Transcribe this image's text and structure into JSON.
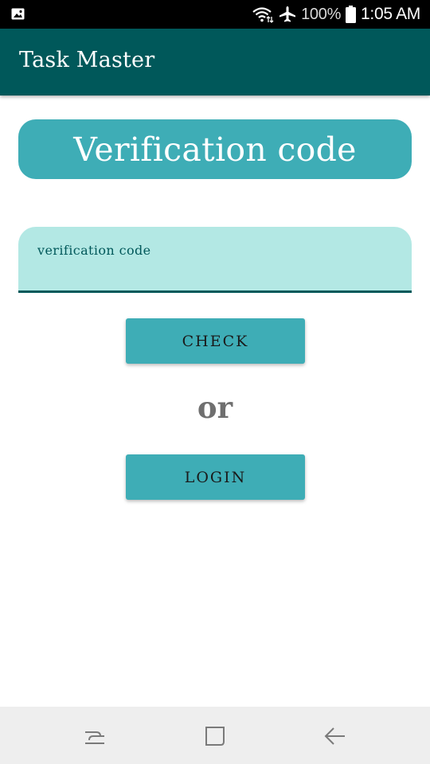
{
  "status_bar": {
    "notification_icon": "gallery-icon",
    "icons": [
      "wifi-icon",
      "airplane-mode-icon",
      "battery-icon"
    ],
    "battery": "100%",
    "time": "1:05 AM"
  },
  "app_bar": {
    "title": "Task Master",
    "color": "#00585a"
  },
  "main": {
    "banner": "Verification code",
    "code_field": {
      "value": "",
      "placeholder": "verification code"
    },
    "check_button": "CHECK",
    "separator": "or",
    "login_button": "LOGIN",
    "accent_color": "#3eadb6"
  },
  "nav_bar": {
    "buttons": [
      "recent-apps-icon",
      "home-icon",
      "back-icon"
    ]
  }
}
